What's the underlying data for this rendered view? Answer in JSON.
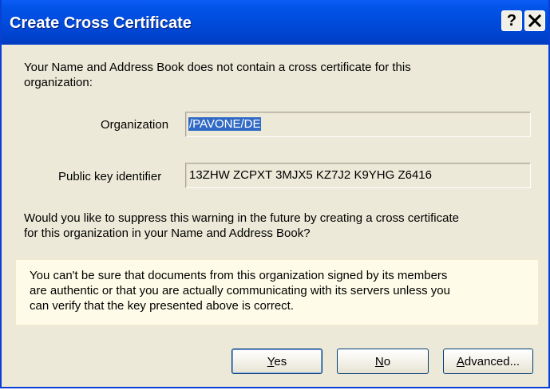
{
  "dialog": {
    "title": "Create Cross Certificate",
    "help_button": "?",
    "intro_line1": "Your Name and Address Book does not contain a cross certificate for this",
    "intro_line2": "organization:",
    "organization_label": "Organization",
    "organization_value": "/PAVONE/DE",
    "key_label": "Public key identifier",
    "key_value": "13ZHW ZCPXT 3MJX5 KZ7J2 K9YHG Z6416",
    "question_line1": "Would you like to suppress this warning in the future by creating a cross certificate",
    "question_line2": "for this organization in your Name and Address Book?",
    "warning_line1": "You can't be sure that documents from this organization signed by its members",
    "warning_line2": "are authentic or that you are actually communicating with its servers unless you",
    "warning_line3": "can verify that the key presented above is correct.",
    "buttons": {
      "yes_first": "Y",
      "yes_rest": "es",
      "no_first": "N",
      "no_rest": "o",
      "advanced_first": "A",
      "advanced_rest": "dvanced..."
    }
  },
  "colors": {
    "titlebar": "#0049d8",
    "dialog_bg": "#ece9d8",
    "warning_bg": "#fefce8",
    "selection": "#316ac5"
  }
}
